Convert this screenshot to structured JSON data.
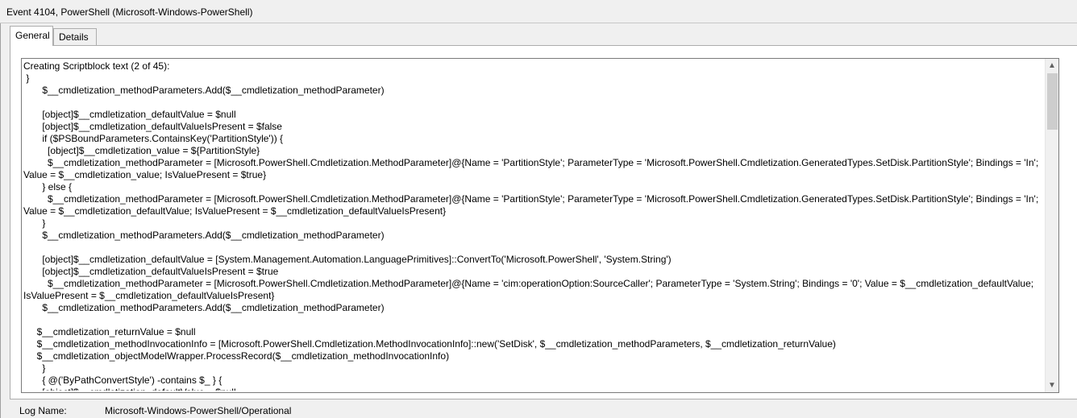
{
  "window": {
    "title": "Event 4104, PowerShell (Microsoft-Windows-PowerShell)"
  },
  "tabs": [
    {
      "label": "General",
      "active": true
    },
    {
      "label": "Details",
      "active": false
    }
  ],
  "event_text": {
    "lines": [
      "Creating Scriptblock text (2 of 45):",
      " }",
      "       $__cmdletization_methodParameters.Add($__cmdletization_methodParameter)",
      "",
      "       [object]$__cmdletization_defaultValue = $null",
      "       [object]$__cmdletization_defaultValueIsPresent = $false",
      "       if ($PSBoundParameters.ContainsKey('PartitionStyle')) {",
      "         [object]$__cmdletization_value = ${PartitionStyle}",
      "         $__cmdletization_methodParameter = [Microsoft.PowerShell.Cmdletization.MethodParameter]@{Name = 'PartitionStyle'; ParameterType = 'Microsoft.PowerShell.Cmdletization.GeneratedTypes.SetDisk.PartitionStyle'; Bindings = 'In';",
      "Value = $__cmdletization_value; IsValuePresent = $true}",
      "       } else {",
      "         $__cmdletization_methodParameter = [Microsoft.PowerShell.Cmdletization.MethodParameter]@{Name = 'PartitionStyle'; ParameterType = 'Microsoft.PowerShell.Cmdletization.GeneratedTypes.SetDisk.PartitionStyle'; Bindings = 'In';",
      "Value = $__cmdletization_defaultValue; IsValuePresent = $__cmdletization_defaultValueIsPresent}",
      "       }",
      "       $__cmdletization_methodParameters.Add($__cmdletization_methodParameter)",
      "",
      "       [object]$__cmdletization_defaultValue = [System.Management.Automation.LanguagePrimitives]::ConvertTo('Microsoft.PowerShell', 'System.String')",
      "       [object]$__cmdletization_defaultValueIsPresent = $true",
      "         $__cmdletization_methodParameter = [Microsoft.PowerShell.Cmdletization.MethodParameter]@{Name = 'cim:operationOption:SourceCaller'; ParameterType = 'System.String'; Bindings = '0'; Value = $__cmdletization_defaultValue;",
      "IsValuePresent = $__cmdletization_defaultValueIsPresent}",
      "       $__cmdletization_methodParameters.Add($__cmdletization_methodParameter)",
      "",
      "     $__cmdletization_returnValue = $null",
      "     $__cmdletization_methodInvocationInfo = [Microsoft.PowerShell.Cmdletization.MethodInvocationInfo]::new('SetDisk', $__cmdletization_methodParameters, $__cmdletization_returnValue)",
      "     $__cmdletization_objectModelWrapper.ProcessRecord($__cmdletization_methodInvocationInfo)",
      "       }",
      "       { @('ByPathConvertStyle') -contains $_ } {",
      "       [object]$__cmdletization_defaultValue = $null"
    ]
  },
  "details": {
    "log_name_label": "Log Name:",
    "log_name_value": "Microsoft-Windows-PowerShell/Operational"
  },
  "scrollbar": {
    "up_icon": "▲",
    "down_icon": "▼"
  }
}
